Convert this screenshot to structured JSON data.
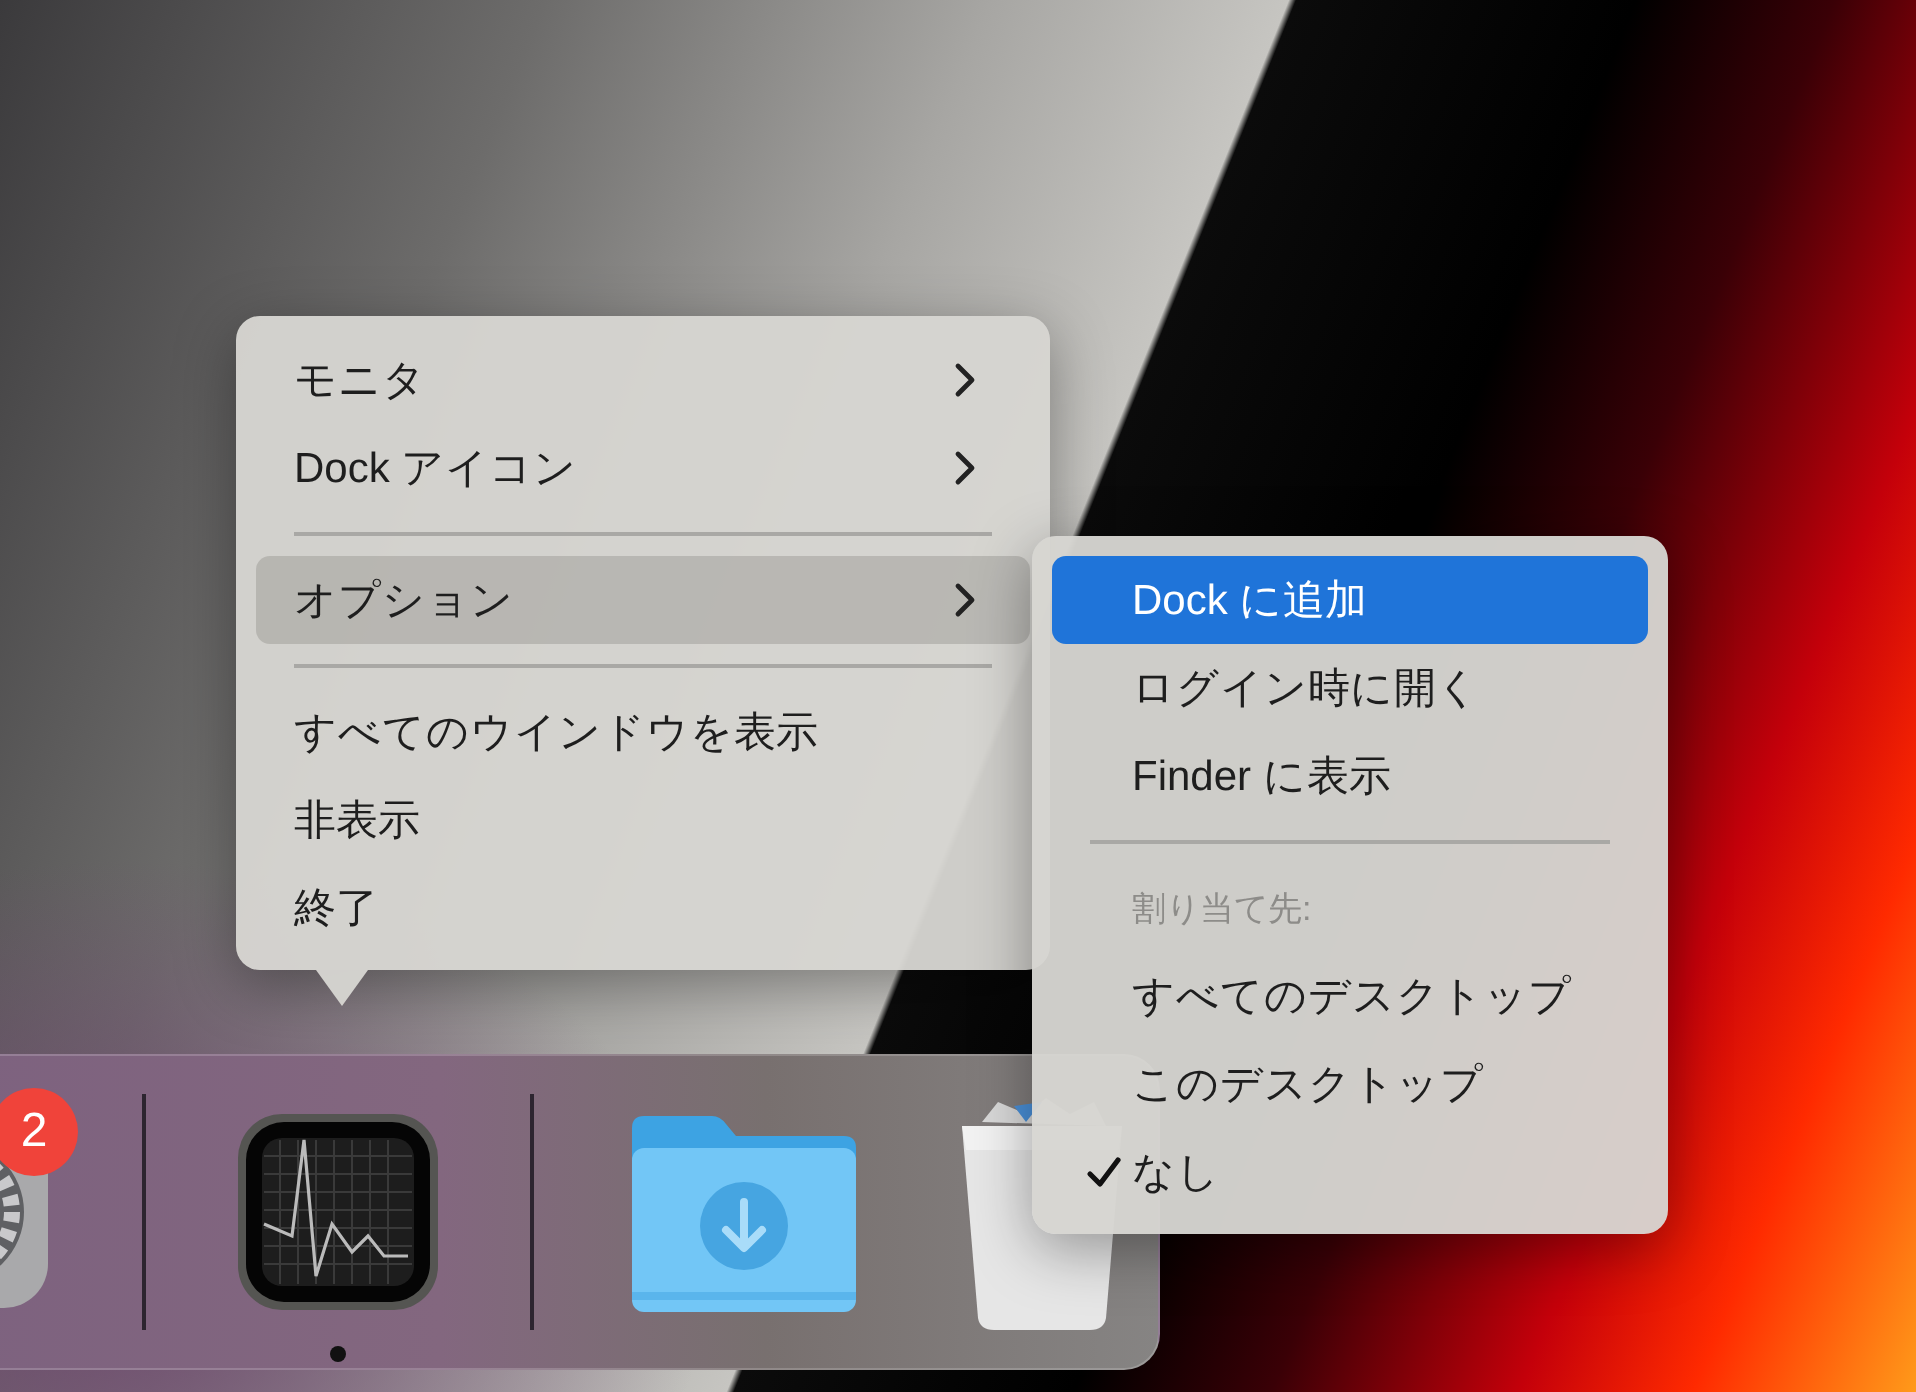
{
  "menu": {
    "items": [
      {
        "kind": "submenu",
        "label": "モニタ",
        "selected": false
      },
      {
        "kind": "submenu",
        "label": "Dock アイコン",
        "selected": false
      },
      {
        "kind": "separator"
      },
      {
        "kind": "submenu",
        "label": "オプション",
        "selected": true
      },
      {
        "kind": "separator"
      },
      {
        "kind": "action",
        "label": "すべてのウインドウを表示",
        "selected": false
      },
      {
        "kind": "action",
        "label": "非表示",
        "selected": false
      },
      {
        "kind": "action",
        "label": "終了",
        "selected": false
      }
    ]
  },
  "submenu": {
    "items": [
      {
        "kind": "action",
        "label": "Dock に追加",
        "selected": true
      },
      {
        "kind": "action",
        "label": "ログイン時に開く",
        "selected": false
      },
      {
        "kind": "action",
        "label": "Finder に表示",
        "selected": false
      },
      {
        "kind": "separator"
      },
      {
        "kind": "header",
        "label": "割り当て先:"
      },
      {
        "kind": "option",
        "label": "すべてのデスクトップ",
        "checked": false
      },
      {
        "kind": "option",
        "label": "このデスクトップ",
        "checked": false
      },
      {
        "kind": "option",
        "label": "なし",
        "checked": true
      }
    ]
  },
  "dock": {
    "items": [
      {
        "kind": "settings",
        "badge": "2"
      },
      {
        "kind": "divider"
      },
      {
        "kind": "monitor",
        "running": true
      },
      {
        "kind": "divider"
      },
      {
        "kind": "downloads",
        "running": false
      },
      {
        "kind": "trash",
        "running": false
      }
    ]
  }
}
